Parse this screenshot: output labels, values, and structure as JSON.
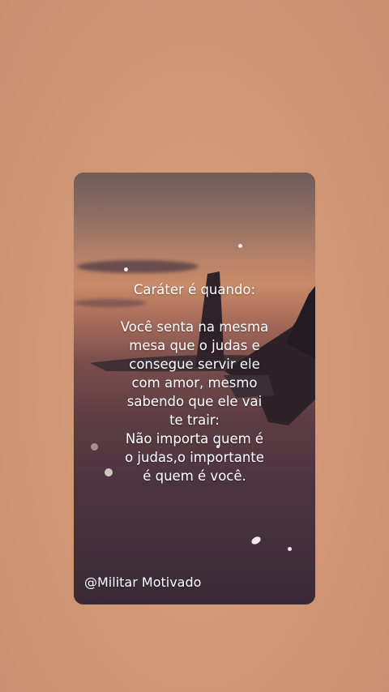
{
  "quote": {
    "title": "Caráter é quando:",
    "lines": [
      "Você senta na mesma",
      "mesa que o judas e",
      "consegue servir ele",
      "com amor, mesmo",
      "sabendo que ele vai",
      "te trair:",
      "Não importa quem é",
      "o judas,o importante",
      "é quem é você."
    ]
  },
  "watermark": "@Militar Motivado",
  "colors": {
    "background": "#d49a78",
    "text": "#ffffff"
  },
  "icons": [
    "fighter-jet-silhouette"
  ]
}
